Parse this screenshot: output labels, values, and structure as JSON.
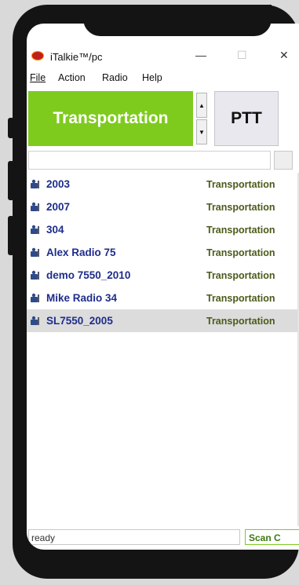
{
  "window": {
    "title": "iTalkie™/pc",
    "minimize": "—",
    "maximize": "☐",
    "close": "✕"
  },
  "menu": {
    "file": "File",
    "action": "Action",
    "radio": "Radio",
    "help": "Help"
  },
  "talkgroup": {
    "label": "Transportation",
    "color": "#7ecb1e"
  },
  "ptt": {
    "label": "PTT"
  },
  "spin": {
    "up": "▲",
    "down": "▼"
  },
  "radios": [
    {
      "name": "2003",
      "group": "Transportation",
      "selected": false
    },
    {
      "name": "2007",
      "group": "Transportation",
      "selected": false
    },
    {
      "name": "304",
      "group": "Transportation",
      "selected": false
    },
    {
      "name": "Alex Radio 75",
      "group": "Transportation",
      "selected": false
    },
    {
      "name": "demo 7550_2010",
      "group": "Transportation",
      "selected": false
    },
    {
      "name": "Mike Radio 34",
      "group": "Transportation",
      "selected": false
    },
    {
      "name": "SL7550_2005",
      "group": "Transportation",
      "selected": true
    }
  ],
  "status": {
    "text": "ready",
    "scan_label": "Scan C"
  }
}
